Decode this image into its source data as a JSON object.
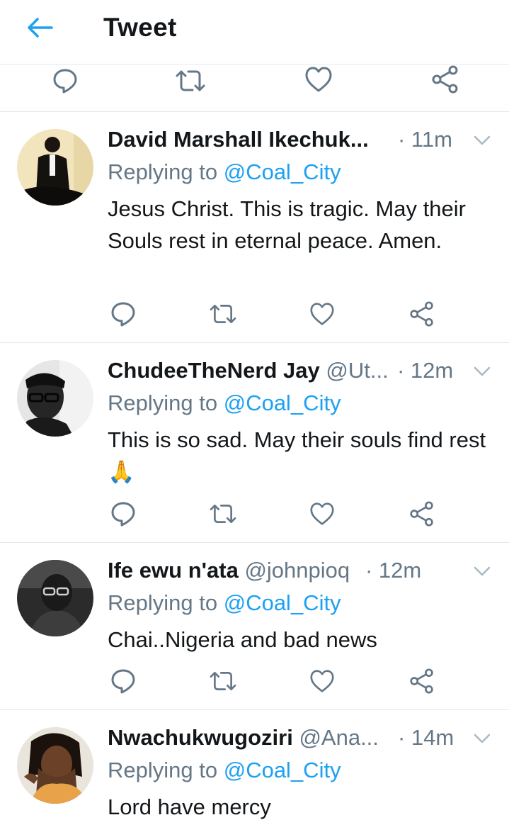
{
  "header": {
    "title": "Tweet",
    "back_icon": "arrow-left-icon"
  },
  "colors": {
    "accent": "#1da1f2",
    "secondary_text": "#657786",
    "primary_text": "#14171a",
    "divider": "#e1e8ed",
    "icon": "#657786"
  },
  "replying_label": "Replying to",
  "tweets": [
    {
      "name": "David Marshall Ikechuk...",
      "handle": "",
      "time": "· 11m",
      "replying_to": "@Coal_City",
      "text": "Jesus Christ. This is tragic.  May their Souls rest in eternal peace. Amen."
    },
    {
      "name": "ChudeeTheNerd Jay",
      "handle": "@Ut...",
      "time": "· 12m",
      "replying_to": "@Coal_City",
      "text": "This is so sad. May their souls find rest🙏"
    },
    {
      "name": "Ife ewu n'ata",
      "handle": "@johnpioq",
      "time": "· 12m",
      "replying_to": "@Coal_City",
      "text": "Chai..Nigeria and bad news"
    },
    {
      "name": "Nwachukwugoziri",
      "handle": "@Ana...",
      "time": "· 14m",
      "replying_to": "@Coal_City",
      "text": "Lord have mercy"
    }
  ]
}
